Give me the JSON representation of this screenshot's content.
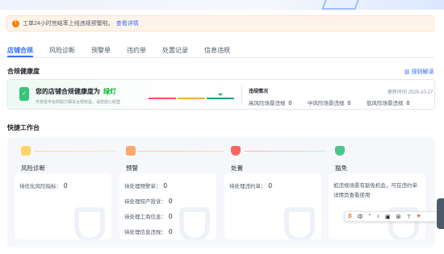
{
  "alert": {
    "text": "工单24小时完结率上线违规预警啦。",
    "link": "查看详情"
  },
  "tabs": [
    "店铺合规",
    "风险诊断",
    "预警单",
    "违约单",
    "处置记录",
    "信息违规"
  ],
  "health": {
    "section_title": "合规健康度",
    "rule_link": "规则解读",
    "title": "您的店铺合规健康度为",
    "level": "绿灯",
    "subtitle": "可享受平台的助力相关合规权益，请您放心经营",
    "violation_title": "违规情况",
    "update_time": "更新时间 2025-10-27",
    "violations": [
      {
        "label": "高风险场景违规",
        "count": "0"
      },
      {
        "label": "中风险场景违规",
        "count": "0"
      },
      {
        "label": "低风险场景违规",
        "count": "0"
      }
    ],
    "level_colors": [
      "#f5535e",
      "#ffa940",
      "#1ea38a"
    ]
  },
  "workbench": {
    "section_title": "快捷工作台",
    "columns": [
      {
        "label": "风险诊断",
        "rows": [
          {
            "label": "待优化风险指标：",
            "count": "0"
          }
        ]
      },
      {
        "label": "预警",
        "rows": [
          {
            "label": "待处理预警单：",
            "count": "0"
          },
          {
            "label": "待处理知产投诉：",
            "count": "0"
          },
          {
            "label": "待处理工商信息：",
            "count": "0"
          },
          {
            "label": "待处理信息违规：",
            "count": "0"
          }
        ]
      },
      {
        "label": "处置",
        "rows": [
          {
            "label": "待处理违约单：",
            "count": "0"
          }
        ]
      },
      {
        "label": "豁免",
        "text": "如违规场景有豁免机会，可在违约单详情页查看使用"
      }
    ]
  },
  "toolbar": {
    "items": [
      "S",
      "中",
      "°",
      "♪",
      "▣",
      "⊞",
      "⊤",
      "♥"
    ]
  }
}
